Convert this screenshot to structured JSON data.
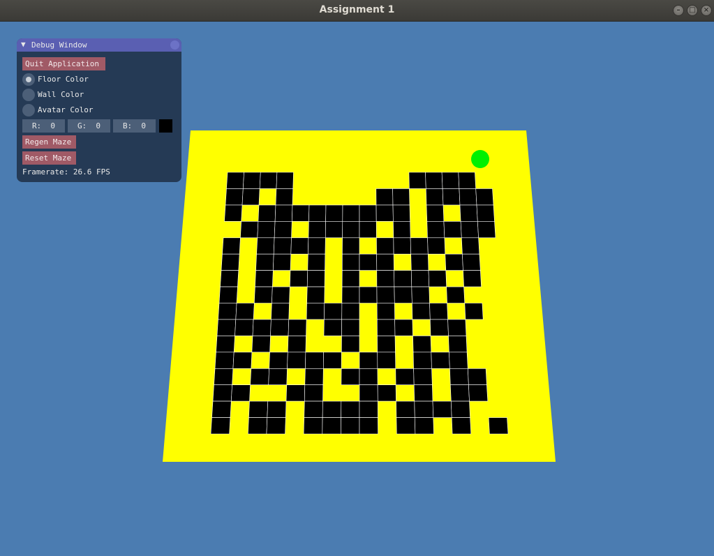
{
  "window": {
    "title": "Assignment 1",
    "controls": {
      "minimize": "–",
      "maximize": "□",
      "close": "×"
    }
  },
  "debug": {
    "title": "Debug Window",
    "collapse_glyph": "▼",
    "quit_label": "Quit Application",
    "radio": [
      {
        "label": "Floor Color",
        "selected": true
      },
      {
        "label": "Wall Color",
        "selected": false
      },
      {
        "label": "Avatar Color",
        "selected": false
      }
    ],
    "r_field": "R:  0",
    "g_field": "G:  0",
    "b_field": "B:  0",
    "regen_label": "Regen Maze",
    "reset_label": "Reset Maze",
    "framerate": "Framerate: 26.6 FPS"
  },
  "scene": {
    "background": "#4b7cb1",
    "floor_color": "#ffff00",
    "wall_color": "#000000",
    "avatar_color": "#00f000",
    "grid_size": 16,
    "maze_rows": [
      "####.......####",
      "##.#.....##.####",
      "#.#########.#.##",
      ".###.####.#.####",
      "#.####.#.####.#",
      "#.##.#.###.#.##",
      "#.#.##.#.####.#",
      "#.##.#.#####.#",
      "##.#.###.#.##.#",
      "#####.##.##.##",
      "#.#.#..#.#.#.#",
      "##.####.##.###",
      "#.##.#.##.##.##",
      "##..##..##.#.##",
      "#.##.####.####",
      "#.##.####.##.#.##"
    ]
  }
}
